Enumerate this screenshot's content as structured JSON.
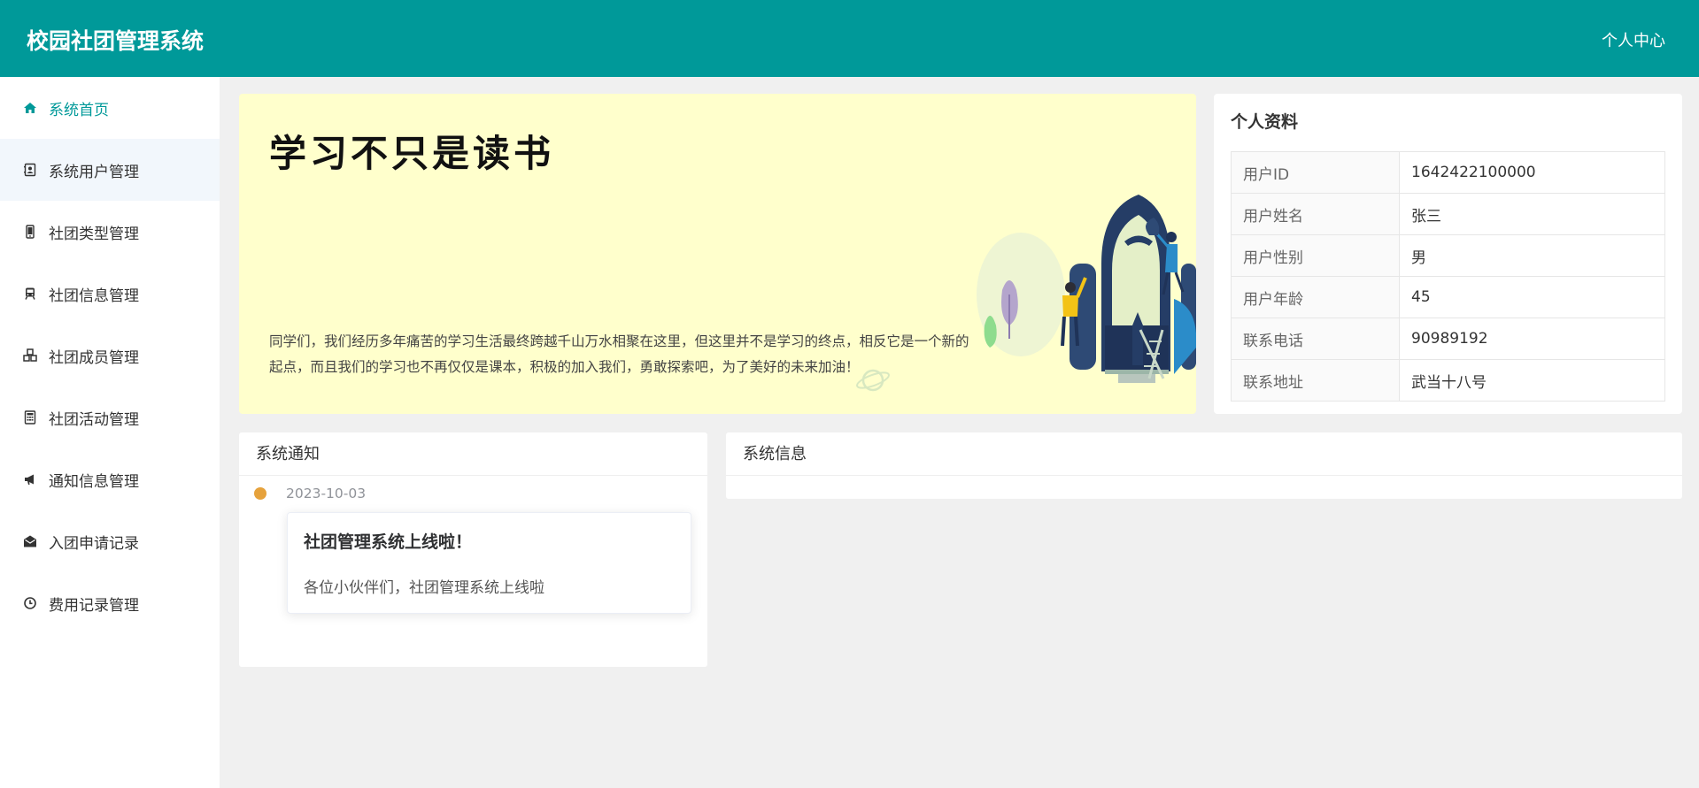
{
  "header": {
    "app_title": "校园社团管理系统",
    "user_center": "个人中心",
    "brand_color": "#009999"
  },
  "sidebar": {
    "items": [
      {
        "label": "系统首页",
        "icon": "home-icon",
        "active": true
      },
      {
        "label": "系统用户管理",
        "icon": "address-book-icon"
      },
      {
        "label": "社团类型管理",
        "icon": "mobile-icon"
      },
      {
        "label": "社团信息管理",
        "icon": "train-icon"
      },
      {
        "label": "社团成员管理",
        "icon": "cubes-icon"
      },
      {
        "label": "社团活动管理",
        "icon": "calculator-icon"
      },
      {
        "label": "通知信息管理",
        "icon": "bullhorn-icon"
      },
      {
        "label": "入团申请记录",
        "icon": "envelope-open-icon"
      },
      {
        "label": "费用记录管理",
        "icon": "clock-icon"
      }
    ]
  },
  "banner": {
    "headline": "学习不只是读书",
    "paragraph": "同学们，我们经历多年痛苦的学习生活最终跨越千山万水相聚在这里，但这里并不是学习的终点，相反它是一个新的起点，而且我们的学习也不再仅仅是课本，积极的加入我们，勇敢探索吧，为了美好的未来加油！"
  },
  "profile": {
    "title": "个人资料",
    "rows": [
      {
        "key": "用户ID",
        "value": "1642422100000"
      },
      {
        "key": "用户姓名",
        "value": "张三"
      },
      {
        "key": "用户性别",
        "value": "男"
      },
      {
        "key": "用户年龄",
        "value": "45"
      },
      {
        "key": "联系电话",
        "value": "90989192"
      },
      {
        "key": "联系地址",
        "value": "武当十八号"
      }
    ]
  },
  "notice": {
    "title": "系统通知",
    "items": [
      {
        "date": "2023-10-03",
        "title": "社团管理系统上线啦！",
        "body": "各位小伙伴们，社团管理系统上线啦"
      }
    ]
  },
  "sysinfo": {
    "title": "系统信息"
  }
}
